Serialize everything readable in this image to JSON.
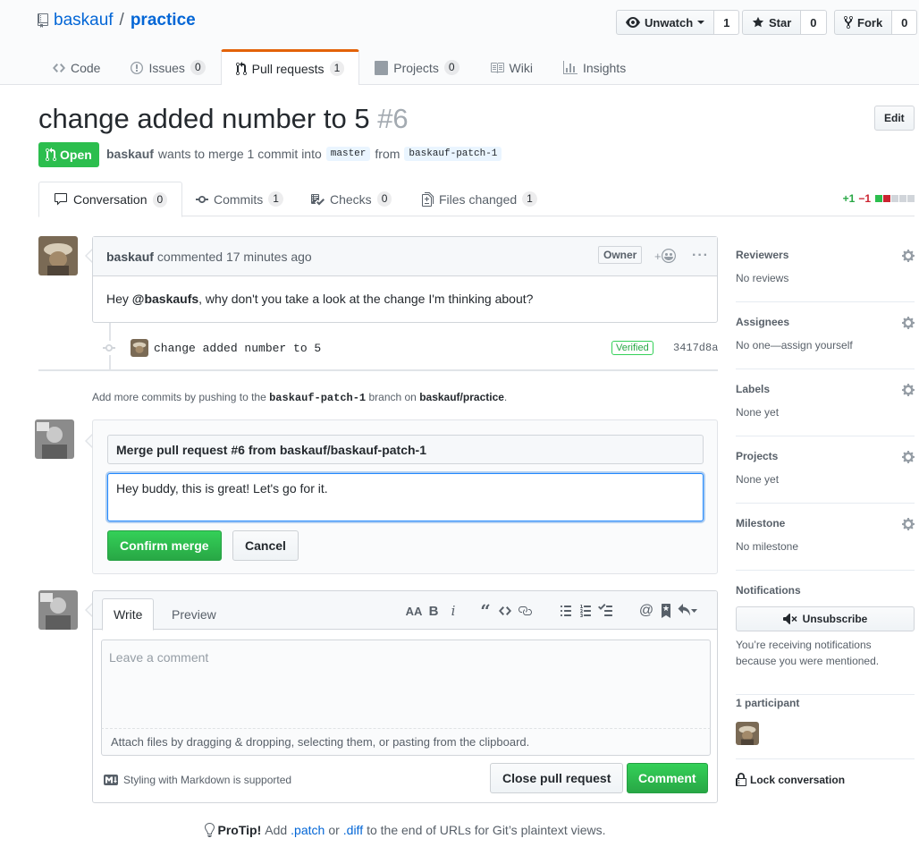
{
  "repo": {
    "owner": "baskauf",
    "separator": "/",
    "name": "practice",
    "actions": {
      "watch_label": "Unwatch",
      "watch_count": "1",
      "star_label": "Star",
      "star_count": "0",
      "fork_label": "Fork",
      "fork_count": "0"
    },
    "nav": [
      {
        "label": "Code",
        "count": ""
      },
      {
        "label": "Issues",
        "count": "0"
      },
      {
        "label": "Pull requests",
        "count": "1"
      },
      {
        "label": "Projects",
        "count": "0"
      },
      {
        "label": "Wiki",
        "count": ""
      },
      {
        "label": "Insights",
        "count": ""
      }
    ]
  },
  "pr": {
    "title": "change added number to 5",
    "number": "#6",
    "edit_label": "Edit",
    "state": "Open",
    "author": "baskauf",
    "meta_text": "wants to merge 1 commit into",
    "base_branch": "master",
    "from_text": "from",
    "head_branch": "baskauf-patch-1",
    "tabs": [
      {
        "label": "Conversation",
        "count": "0"
      },
      {
        "label": "Commits",
        "count": "1"
      },
      {
        "label": "Checks",
        "count": "0"
      },
      {
        "label": "Files changed",
        "count": "1"
      }
    ],
    "diffstat": {
      "additions": "+1",
      "deletions": "−1"
    }
  },
  "comment": {
    "author": "baskauf",
    "time_text": "commented 17 minutes ago",
    "owner_badge": "Owner",
    "body_prefix": "Hey ",
    "body_mention": "@baskaufs",
    "body_suffix": ", why don't you take a look at the change I'm thinking about?"
  },
  "commit": {
    "message": "change added number to 5",
    "verified": "Verified",
    "sha": "3417d8a"
  },
  "hint": {
    "prefix": "Add more commits by pushing to the",
    "branch": "baskauf-patch-1",
    "middle": "branch on",
    "repo": "baskauf/practice",
    "suffix": "."
  },
  "merge": {
    "title_value": "Merge pull request #6 from baskauf/baskauf-patch-1",
    "message_value": "Hey buddy, this is great!  Let's go for it.",
    "confirm_label": "Confirm merge",
    "cancel_label": "Cancel"
  },
  "new_comment": {
    "tab_write": "Write",
    "tab_preview": "Preview",
    "placeholder": "Leave a comment",
    "attach_text": "Attach files by dragging & dropping, selecting them, or pasting from the clipboard.",
    "markdown_hint": "Styling with Markdown is supported",
    "close_label": "Close pull request",
    "comment_label": "Comment"
  },
  "protip": {
    "label": "ProTip!",
    "text1": "Add",
    "patch": ".patch",
    "or": "or",
    "diff": ".diff",
    "text2": "to the end of URLs for Git’s plaintext views."
  },
  "sidebar": {
    "reviewers": {
      "heading": "Reviewers",
      "value": "No reviews"
    },
    "assignees": {
      "heading": "Assignees",
      "value": "No one—assign yourself"
    },
    "labels": {
      "heading": "Labels",
      "value": "None yet"
    },
    "projects": {
      "heading": "Projects",
      "value": "None yet"
    },
    "milestone": {
      "heading": "Milestone",
      "value": "No milestone"
    },
    "notifications": {
      "heading": "Notifications",
      "button_label": "Unsubscribe",
      "reason": "You’re receiving notifications because you were mentioned."
    },
    "participants": {
      "heading": "1 participant"
    },
    "lock_label": "Lock conversation"
  },
  "colors": {
    "accent": "#0366d6",
    "open_green": "#2cbe4e",
    "selected_tab_orange": "#e36209",
    "add_green": "#28a745",
    "del_red": "#cb2431"
  },
  "icons": [
    "repo-icon",
    "eye-icon",
    "star-icon",
    "fork-icon",
    "code-icon",
    "issue-icon",
    "pull-request-icon",
    "project-icon",
    "wiki-icon",
    "graph-icon",
    "comment-icon",
    "commit-icon",
    "checklist-icon",
    "file-diff-icon",
    "smiley-icon",
    "kebab-icon",
    "markdown-icon",
    "lightbulb-icon",
    "gear-icon",
    "mute-icon",
    "lock-icon"
  ]
}
